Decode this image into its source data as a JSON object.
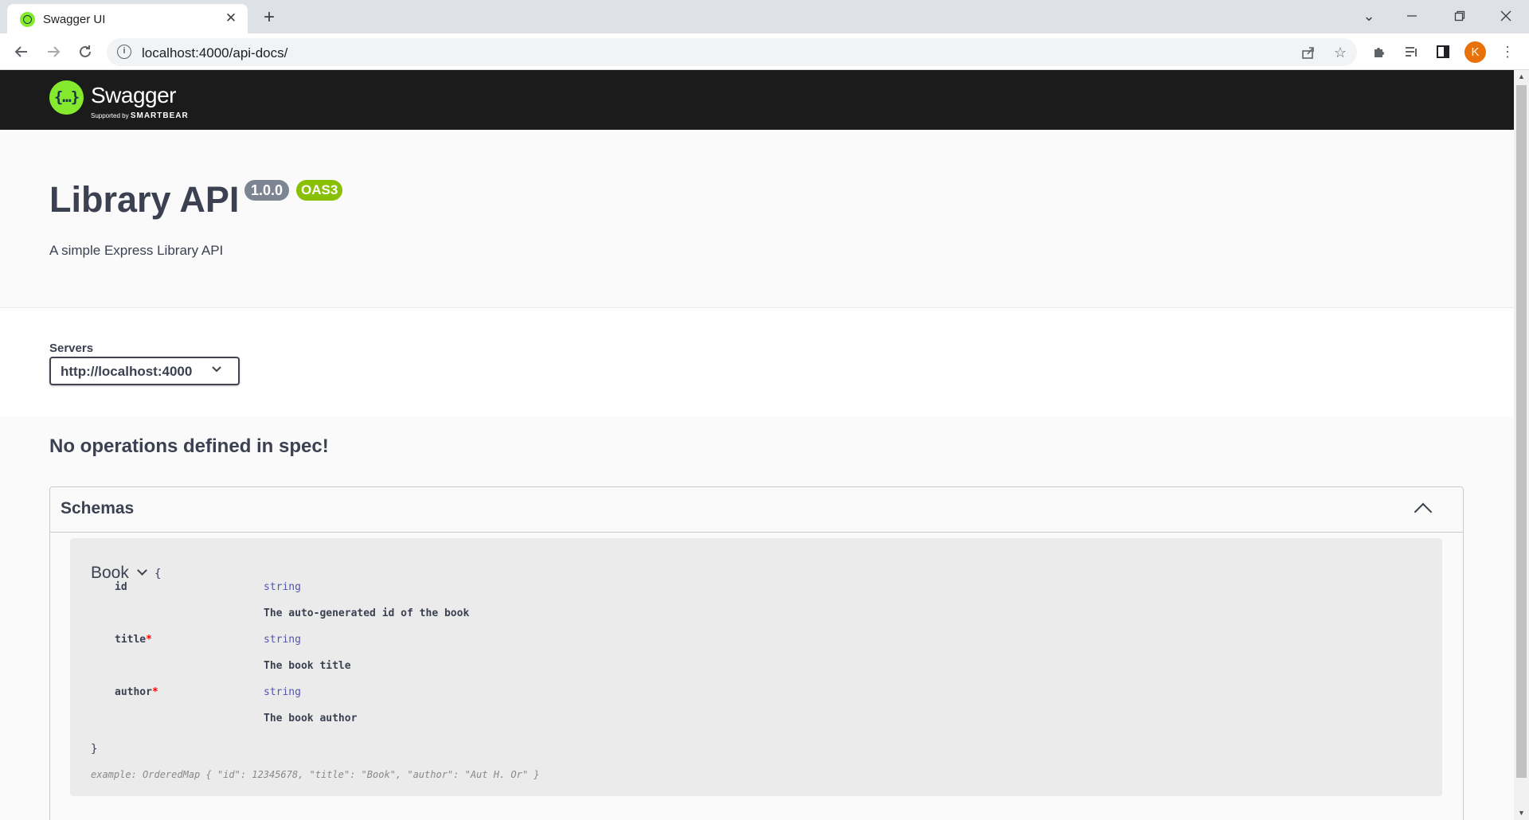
{
  "browser": {
    "tab_title": "Swagger UI",
    "url": "localhost:4000/api-docs/",
    "profile_initial": "K"
  },
  "swagger": {
    "logo_text": "Swagger",
    "logo_sub_prefix": "Supported by",
    "logo_sub_brand": "SMARTBEAR"
  },
  "info": {
    "title": "Library API",
    "version": "1.0.0",
    "oas_badge": "OAS3",
    "description": "A simple Express Library API"
  },
  "servers": {
    "label": "Servers",
    "selected": "http://localhost:4000"
  },
  "operations": {
    "empty_message": "No operations defined in spec!"
  },
  "schemas": {
    "title": "Schemas",
    "models": [
      {
        "name": "Book",
        "open_brace": "{",
        "close_brace": "}",
        "properties": [
          {
            "name": "id",
            "required": false,
            "type": "string",
            "description": "The auto-generated id of the book"
          },
          {
            "name": "title",
            "required": true,
            "type": "string",
            "description": "The book title"
          },
          {
            "name": "author",
            "required": true,
            "type": "string",
            "description": "The book author"
          }
        ],
        "example": "example: OrderedMap { \"id\": 12345678, \"title\": \"Book\", \"author\": \"Aut H. Or\" }"
      }
    ]
  },
  "colors": {
    "swagger_green": "#85ea2d",
    "topbar_bg": "#1b1b1b",
    "version_badge": "#7d8492",
    "oas_badge": "#89bf04",
    "text_primary": "#3b4151",
    "type_color": "#5555aa",
    "required_asterisk": "#ff0000",
    "avatar_bg": "#e8710a"
  }
}
